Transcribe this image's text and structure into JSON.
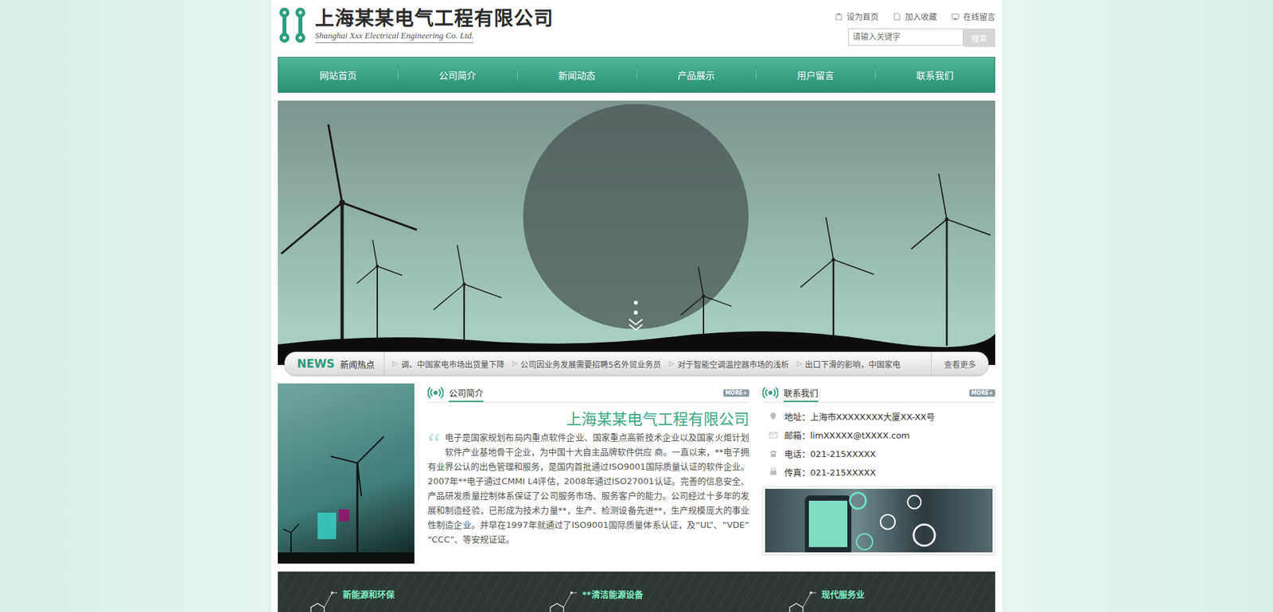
{
  "header": {
    "title": "上海某某电气工程有限公司",
    "subtitle": "Shanghai Xxx Electrical Engineering Co. Ltd.",
    "links": [
      "设为首页",
      "加入收藏",
      "在线留言"
    ],
    "search": {
      "placeholder": "请输入关键字",
      "button": "搜索"
    }
  },
  "nav": [
    "网站首页",
    "公司简介",
    "新闻动态",
    "产品展示",
    "用户留言",
    "联系我们"
  ],
  "news": {
    "label": "NEWS",
    "title": "新闻热点",
    "bullet": "▷",
    "items": [
      "调、中国家电市场出货量下降",
      "公司因业务发展需要招聘5名外贸业务员",
      "对于智能空调温控器市场的浅析",
      "出口下滑的影响，中国家电"
    ],
    "more": "查看更多"
  },
  "intro": {
    "title": "公司简介",
    "more": "MORE+",
    "heading": "上海某某电气工程有限公司",
    "quote": "“",
    "text": "电子是国家规划布局内重点软件企业、国家重点高新技术企业以及国家火炬计划软件产业基地骨干企业，为中国十大自主品牌软件供应 商。一直以来，**电子拥有业界公认的出色管理和服务，是国内首批通过ISO9001国际质量认证的软件企业。2007年**电子通过CMMI L4评估，2008年通过ISO27001认证。完善的信息安全、产品研发质量控制体系保证了公司服务市场、服务客户的能力。公司经过十多年的发展和制造经验，已形成为技术力量**，生产、检测设备先进**，生产规模庞大的事业性制造企业。并早在1997年就通过了ISO9001国际质量体系认证，及“UL”、“VDE” “CCC”、等安规证证。"
  },
  "contact": {
    "title": "联系我们",
    "more": "MORE+",
    "rows": [
      "地址：上海市XXXXXXXX大厦XX-XX号",
      "邮箱：limXXXXX@tXXXX.com",
      "电话：021-215XXXXX",
      "传真：021-215XXXXX"
    ]
  },
  "features": [
    "新能源和环保",
    "**清洁能源设备",
    "现代服务业"
  ]
}
